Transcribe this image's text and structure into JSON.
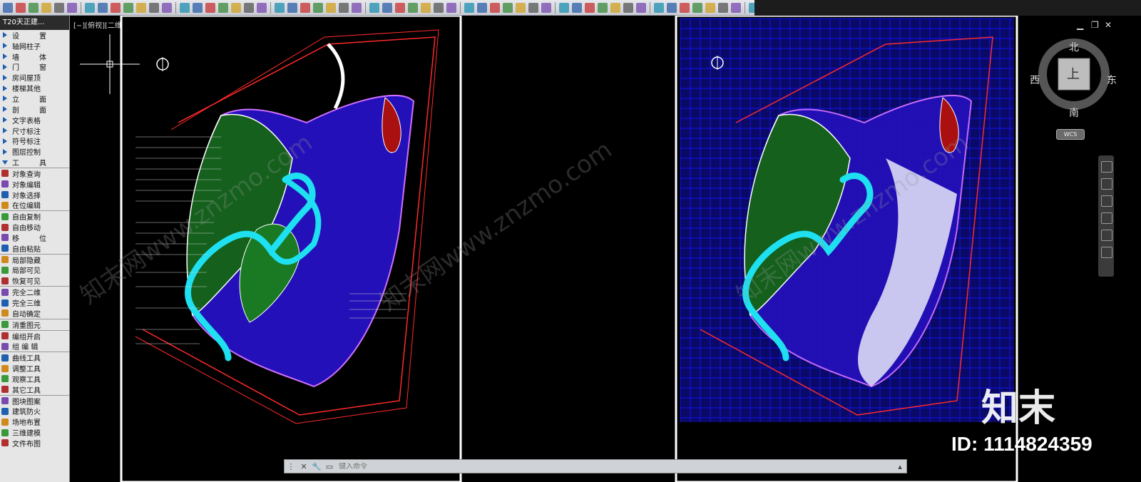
{
  "app": {
    "sidebar_title": "T20天正建...",
    "viewport_label": "[−][俯视][二维线框]"
  },
  "toolbar": {
    "icon_count": 56
  },
  "sidebar": {
    "items": [
      {
        "label": "设　置",
        "icon": "settings-icon",
        "wide": true
      },
      {
        "label": "轴网柱子",
        "icon": "axis-grid-icon"
      },
      {
        "label": "墙　体",
        "icon": "wall-icon",
        "wide": true
      },
      {
        "label": "门　窗",
        "icon": "door-window-icon",
        "wide": true
      },
      {
        "label": "房间屋顶",
        "icon": "room-roof-icon"
      },
      {
        "label": "楼梯其他",
        "icon": "stairs-icon"
      },
      {
        "label": "立　面",
        "icon": "elevation-icon",
        "wide": true
      },
      {
        "label": "剖　面",
        "icon": "section-icon",
        "wide": true
      },
      {
        "label": "文字表格",
        "icon": "text-table-icon"
      },
      {
        "label": "尺寸标注",
        "icon": "dimension-icon"
      },
      {
        "label": "符号标注",
        "icon": "symbol-icon"
      },
      {
        "label": "图层控制",
        "icon": "layer-icon"
      },
      {
        "label": "工　具",
        "icon": "tools-icon",
        "wide": true,
        "expanded": true
      },
      {
        "label": "对象查询",
        "icon": "query-icon",
        "sep": true
      },
      {
        "label": "对象编辑",
        "icon": "edit-icon"
      },
      {
        "label": "对象选择",
        "icon": "select-icon"
      },
      {
        "label": "在位编辑",
        "icon": "inplace-edit-icon"
      },
      {
        "label": "自由复制",
        "icon": "copy-icon",
        "sep": true
      },
      {
        "label": "自由移动",
        "icon": "move-free-icon"
      },
      {
        "label": "移　位",
        "icon": "move-icon",
        "wide": true
      },
      {
        "label": "自由粘贴",
        "icon": "paste-icon"
      },
      {
        "label": "局部隐藏",
        "icon": "hide-icon",
        "sep": true
      },
      {
        "label": "局部可见",
        "icon": "show-icon"
      },
      {
        "label": "恢复可见",
        "icon": "restore-icon"
      },
      {
        "label": "完全二维",
        "icon": "2d-icon",
        "sep": true
      },
      {
        "label": "完全三维",
        "icon": "3d-icon"
      },
      {
        "label": "自动确定",
        "icon": "auto-icon"
      },
      {
        "label": "消重图元",
        "icon": "dedupe-icon",
        "sep": true
      },
      {
        "label": "编组开启",
        "icon": "group-on-icon",
        "sep": true
      },
      {
        "label": "组 编 辑",
        "icon": "group-edit-icon"
      },
      {
        "label": "曲线工具",
        "icon": "curve-icon",
        "sep": true
      },
      {
        "label": "调整工具",
        "icon": "adjust-icon"
      },
      {
        "label": "观察工具",
        "icon": "view-icon"
      },
      {
        "label": "其它工具",
        "icon": "other-tools-icon"
      },
      {
        "label": "图块图案",
        "icon": "block-icon",
        "sep": true
      },
      {
        "label": "建筑防火",
        "icon": "fire-icon"
      },
      {
        "label": "场地布置",
        "icon": "site-icon"
      },
      {
        "label": "三维建模",
        "icon": "3d-model-icon"
      },
      {
        "label": "文件布图",
        "icon": "file-layout-icon"
      }
    ]
  },
  "command": {
    "placeholder": "键入命令"
  },
  "viewcube": {
    "north": "北",
    "south": "南",
    "east": "东",
    "west": "西",
    "top": "上",
    "wcs": "WCS"
  },
  "watermarks": [
    "知末网www.znzmo.com",
    "知末网www.znzmo.com",
    "知末网www.znzmo.com"
  ],
  "brand": {
    "logo": "知末",
    "id": "ID: 1114824359"
  },
  "colors": {
    "water": "#1ee0f0",
    "planting": "#1d8a2e",
    "paths": "#3b1bff",
    "boundary": "#ff2a2a",
    "grid": "#1111ee"
  }
}
